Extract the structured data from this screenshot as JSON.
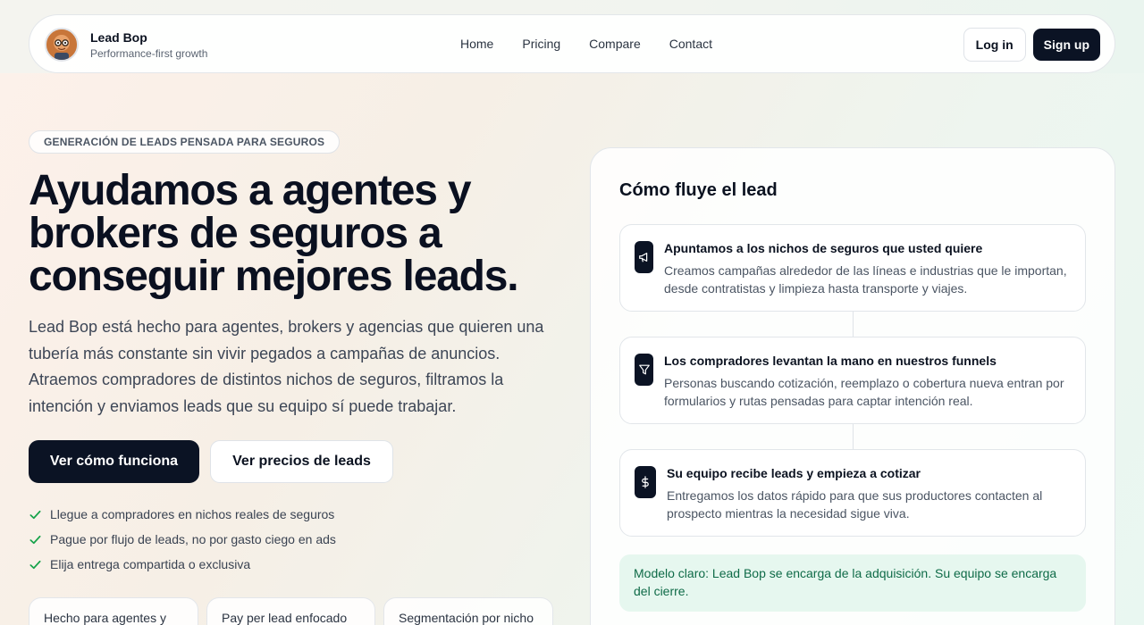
{
  "brand": {
    "name": "Lead Bop",
    "tagline": "Performance-first growth"
  },
  "nav": {
    "links": [
      "Home",
      "Pricing",
      "Compare",
      "Contact"
    ],
    "login_label": "Log in",
    "signup_label": "Sign up"
  },
  "hero": {
    "eyebrow": "GENERACIÓN DE LEADS PENSADA PARA SEGUROS",
    "title": "Ayudamos a agentes y brokers de seguros a conseguir mejores leads.",
    "description": "Lead Bop está hecho para agentes, brokers y agencias que quieren una tubería más constante sin vivir pegados a campañas de anuncios. Atraemos compradores de distintos nichos de seguros, filtramos la intención y enviamos leads que su equipo sí puede trabajar.",
    "cta_primary": "Ver cómo funciona",
    "cta_secondary": "Ver precios de leads",
    "checks": [
      "Llegue a compradores en nichos reales de seguros",
      "Pague por flujo de leads, no por gasto ciego en ads",
      "Elija entrega compartida o exclusiva"
    ],
    "pills": [
      "Hecho para agentes y",
      "Pay per lead enfocado",
      "Segmentación por nicho"
    ]
  },
  "flow": {
    "title": "Cómo fluye el lead",
    "steps": [
      {
        "icon": "megaphone-icon",
        "title": "Apuntamos a los nichos de seguros que usted quiere",
        "text": "Creamos campañas alrededor de las líneas e industrias que le importan, desde contratistas y limpieza hasta transporte y viajes."
      },
      {
        "icon": "filter-icon",
        "title": "Los compradores levantan la mano en nuestros funnels",
        "text": "Personas buscando cotización, reemplazo o cobertura nueva entran por formularios y rutas pensadas para captar intención real."
      },
      {
        "icon": "dollar-icon",
        "title": "Su equipo recibe leads y empieza a cotizar",
        "text": "Entregamos los datos rápido para que sus productores contacten al prospecto mientras la necesidad sigue viva."
      }
    ],
    "note": "Modelo claro: Lead Bop se encarga de la adquisición. Su equipo se encarga del cierre."
  },
  "colors": {
    "primary_dark": "#0b1324",
    "check_green": "#16a34a",
    "note_bg": "#e6f7ef",
    "note_text": "#0f6b48"
  }
}
